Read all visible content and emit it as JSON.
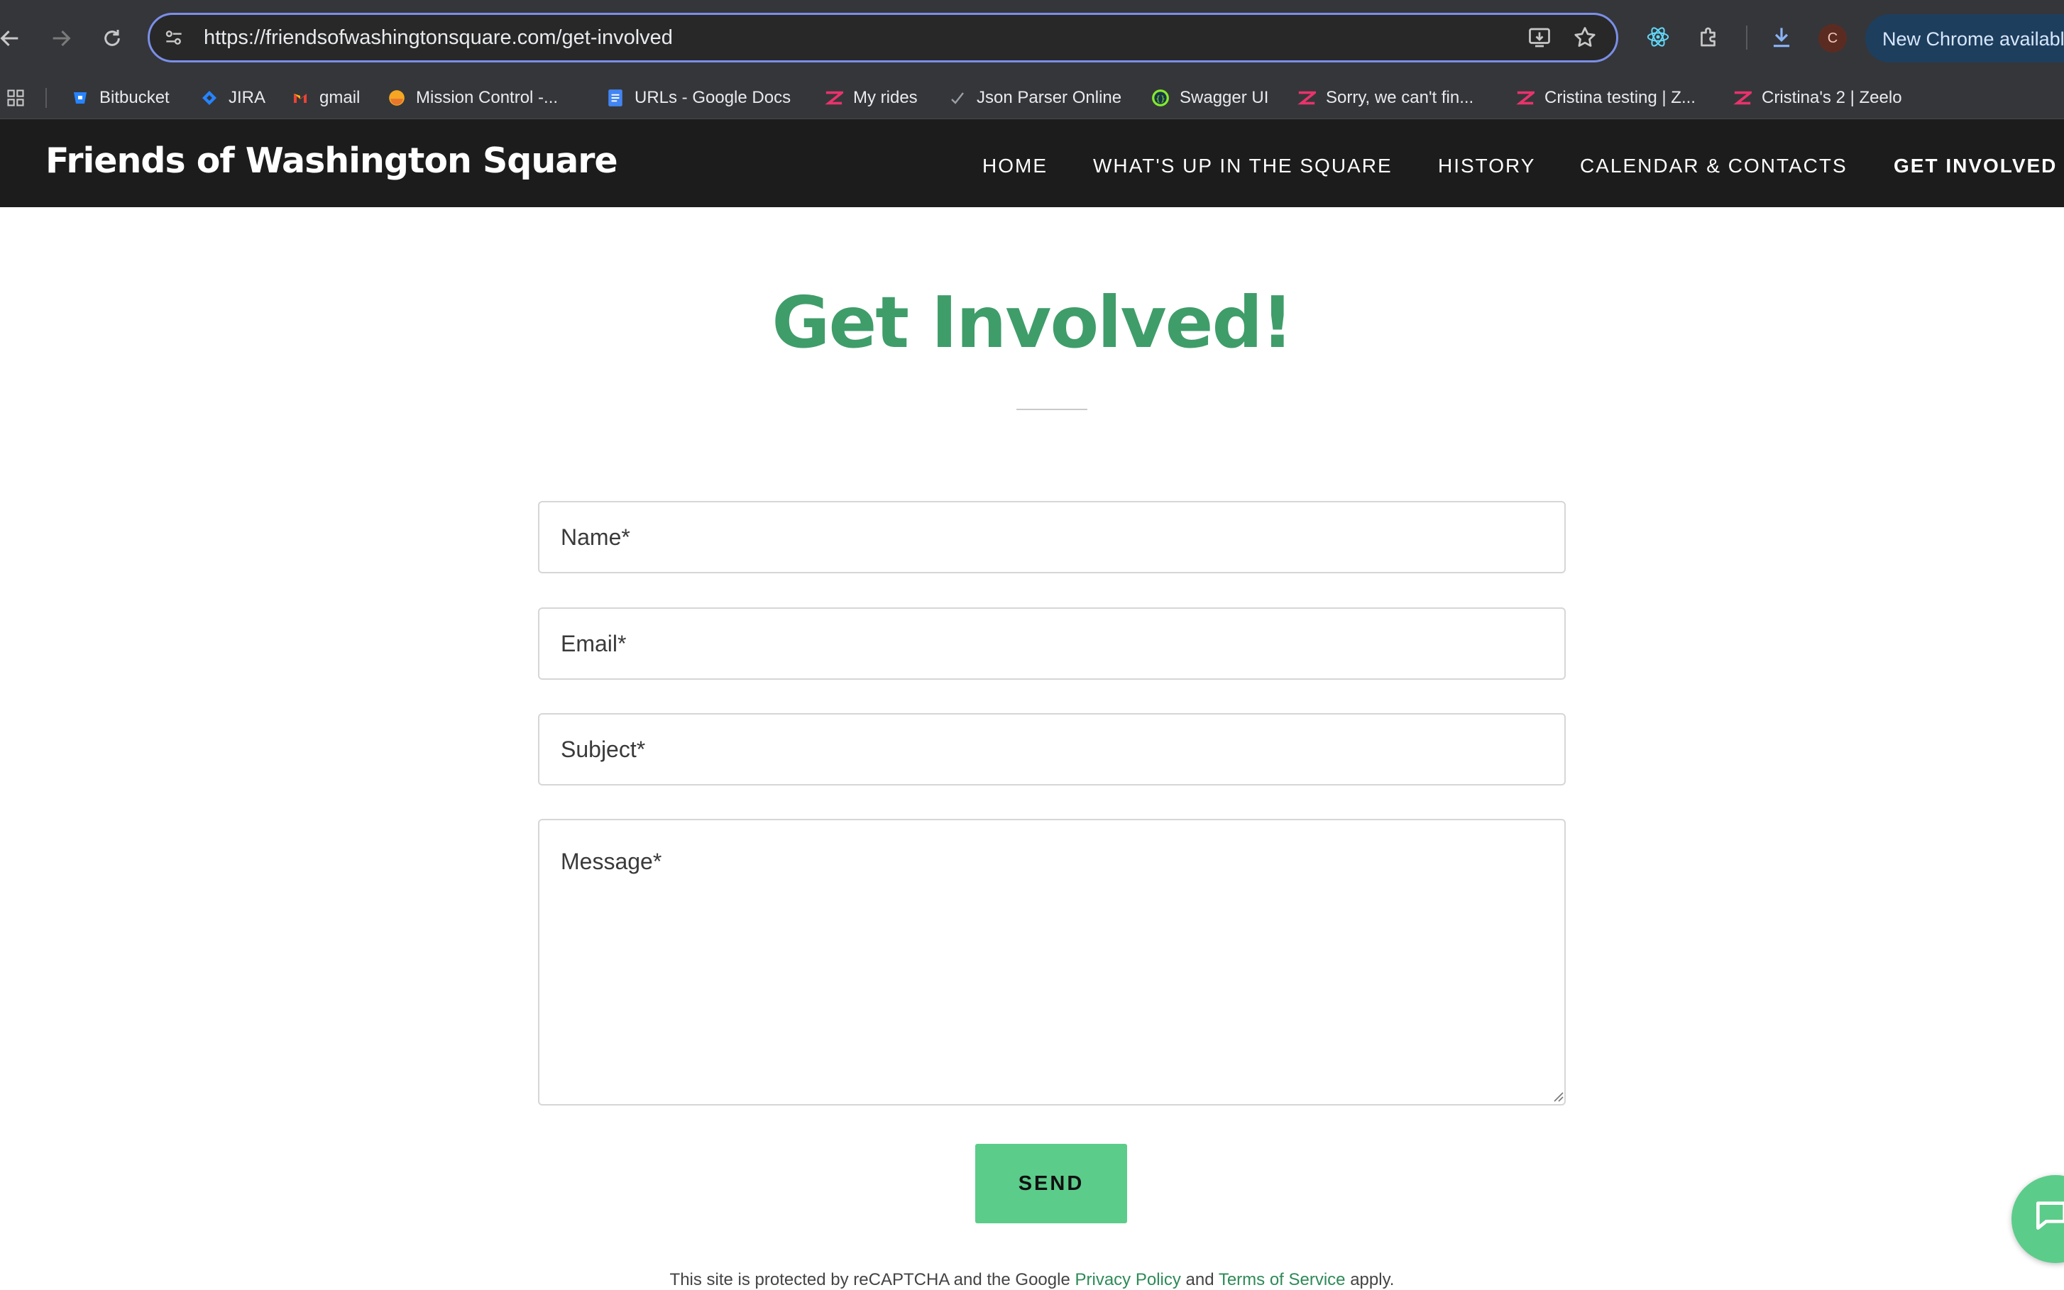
{
  "browser": {
    "url": "https://friendsofwashingtonsquare.com/get-involved",
    "update_label": "New Chrome available",
    "profile_initial": "C",
    "bookmarks": [
      {
        "label": "Bitbucket",
        "icon": "bitbucket-icon"
      },
      {
        "label": "JIRA",
        "icon": "jira-icon"
      },
      {
        "label": "gmail",
        "icon": "gmail-icon"
      },
      {
        "label": "Mission Control -...",
        "icon": "mission-control-icon"
      },
      {
        "label": "URLs - Google Docs",
        "icon": "google-docs-icon"
      },
      {
        "label": "My rides",
        "icon": "zeelo-icon"
      },
      {
        "label": "Json Parser Online",
        "icon": "json-parser-icon"
      },
      {
        "label": "Swagger UI",
        "icon": "swagger-icon"
      },
      {
        "label": "Sorry, we can't fin...",
        "icon": "zeelo-icon"
      },
      {
        "label": "Cristina testing | Z...",
        "icon": "zeelo-icon"
      },
      {
        "label": "Cristina's 2 | Zeelo",
        "icon": "zeelo-icon"
      }
    ]
  },
  "site": {
    "title": "Friends of Washington Square",
    "nav": [
      "HOME",
      "WHAT'S UP IN THE SQUARE",
      "HISTORY",
      "CALENDAR & CONTACTS",
      "GET INVOLVED"
    ]
  },
  "page": {
    "heading": "Get Involved!",
    "form": {
      "name_placeholder": "Name*",
      "email_placeholder": "Email*",
      "subject_placeholder": "Subject*",
      "message_placeholder": "Message*",
      "send_label": "SEND"
    },
    "recaptcha": {
      "prefix": "This site is protected by reCAPTCHA and the Google",
      "privacy_link": "Privacy Policy",
      "and": "and",
      "terms_link": "Terms of Service",
      "suffix": "apply."
    }
  },
  "colors": {
    "accent_green": "#3f9d6a",
    "button_green": "#5ccc8a",
    "header_bg": "#1c1c1c"
  }
}
